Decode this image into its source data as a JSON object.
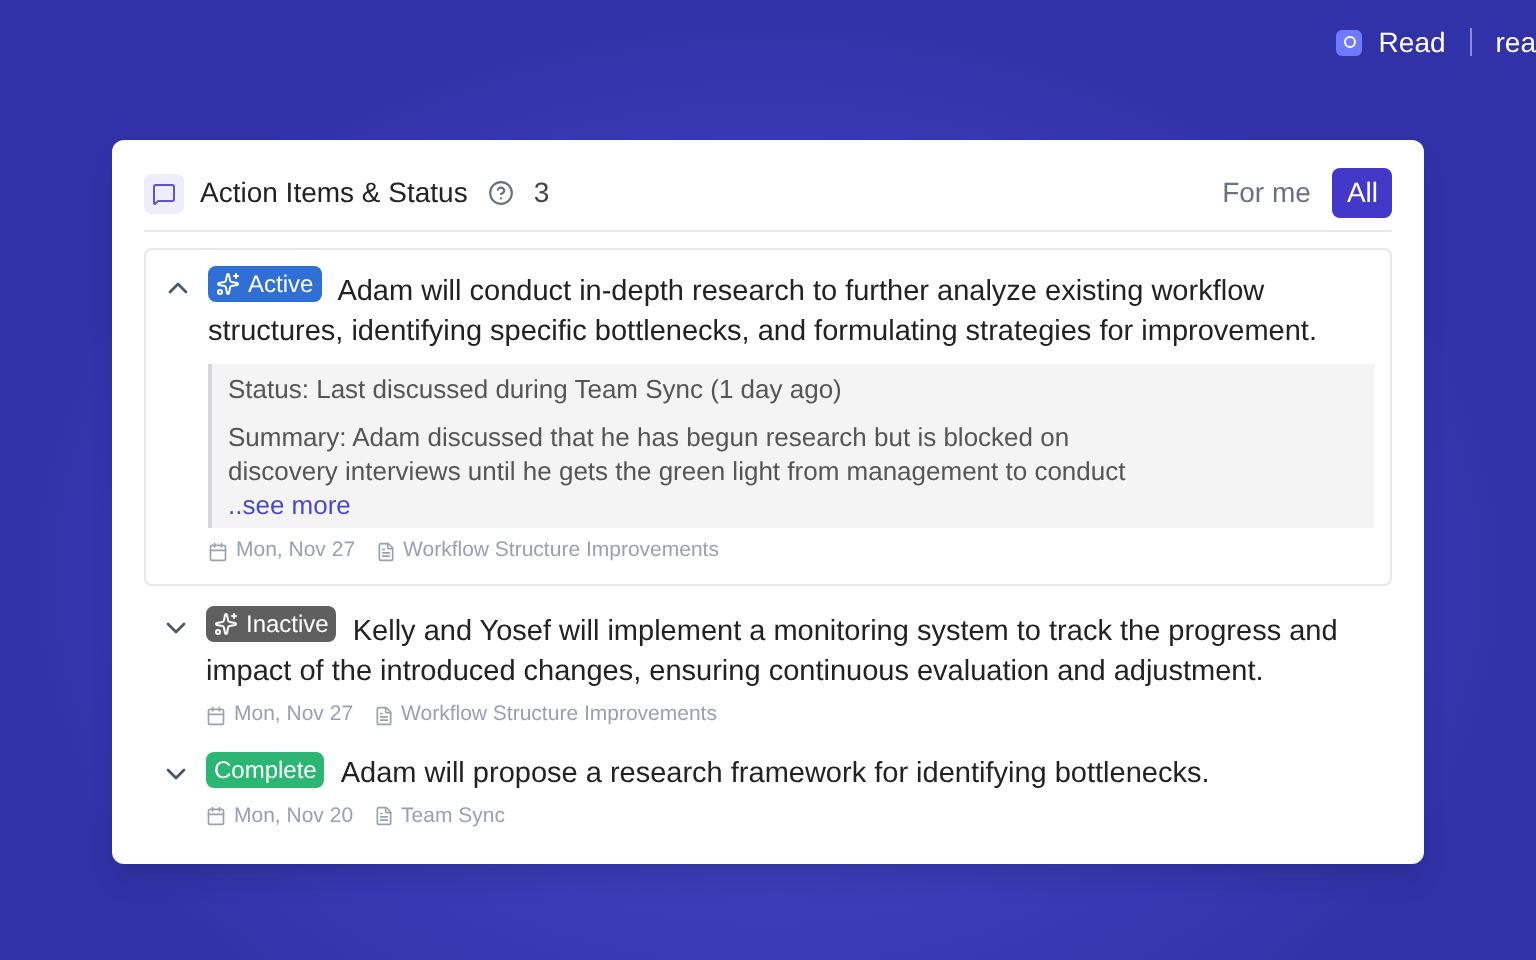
{
  "brand": {
    "name": "Read",
    "cut_text": "rea"
  },
  "panel": {
    "title": "Action Items & Status",
    "count": "3",
    "filters": [
      {
        "label": "For me",
        "selected": false
      },
      {
        "label": "All",
        "selected": true
      }
    ]
  },
  "items": [
    {
      "status": "Active",
      "kind": "active",
      "color": "#2f6fd6",
      "expanded": true,
      "text": "Adam will conduct in-depth research to further analyze existing workflow structures, identifying specific bottlenecks, and formulating strategies for improvement.",
      "details": {
        "status_label": "Status:",
        "status_text": "Last discussed during Team Sync (1 day ago)",
        "summary_label": "Summary:",
        "summary_text": "Adam discussed that he has begun research but is blocked on discovery interviews until he gets the green light from management to conduct",
        "see_more": "..see more"
      },
      "date": "Mon, Nov 27",
      "source": "Workflow Structure Improvements"
    },
    {
      "status": "Inactive",
      "kind": "inactive",
      "color": "#5f5f5f",
      "expanded": false,
      "text": "Kelly and Yosef will implement a monitoring system to track the progress and impact of the introduced changes, ensuring continuous evaluation and adjustment.",
      "date": "Mon, Nov 27",
      "source": "Workflow Structure Improvements"
    },
    {
      "status": "Complete",
      "kind": "complete",
      "color": "#2bb673",
      "expanded": false,
      "text": "Adam will propose a research framework for identifying bottlenecks.",
      "date": "Mon, Nov 20",
      "source": "Team Sync"
    }
  ]
}
